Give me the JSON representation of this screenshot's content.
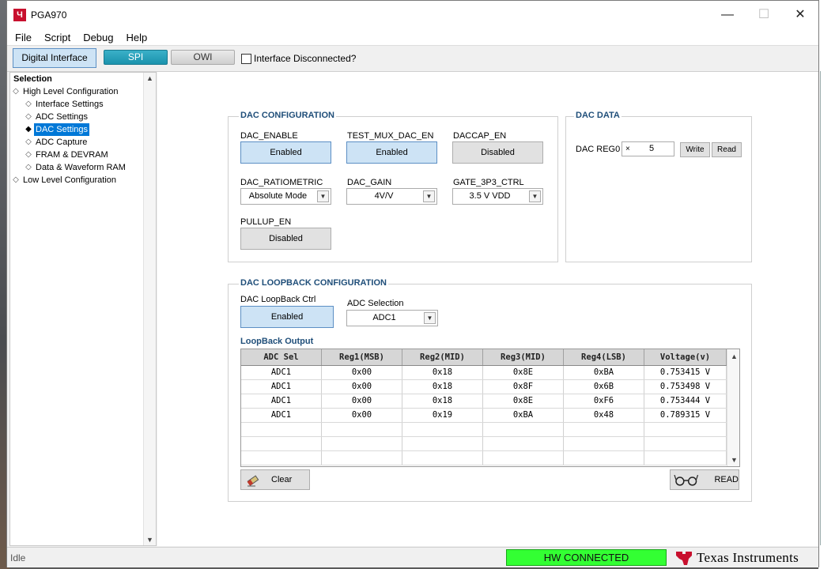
{
  "window": {
    "title": "PGA970",
    "app_icon_glyph": "Ч",
    "min_glyph": "—",
    "max_glyph": "☐",
    "close_glyph": "✕"
  },
  "menu": [
    "File",
    "Script",
    "Debug",
    "Help"
  ],
  "toolbar": {
    "digital_interface": "Digital Interface",
    "spi": "SPI",
    "owi": "OWI",
    "interface_disconnected": "Interface Disconnected?"
  },
  "sidebar": {
    "header": "Selection",
    "items": [
      {
        "label": "High Level Configuration",
        "level": 0
      },
      {
        "label": "Interface Settings",
        "level": 1
      },
      {
        "label": "ADC Settings",
        "level": 1
      },
      {
        "label": "DAC Settings",
        "level": 1,
        "selected": true
      },
      {
        "label": "ADC Capture",
        "level": 1
      },
      {
        "label": "FRAM & DEVRAM",
        "level": 1
      },
      {
        "label": "Data & Waveform RAM",
        "level": 1
      },
      {
        "label": "Low Level Configuration",
        "level": 0
      }
    ]
  },
  "dac_config": {
    "title": "DAC CONFIGURATION",
    "dac_enable": {
      "label": "DAC_ENABLE",
      "value": "Enabled"
    },
    "test_mux": {
      "label": "TEST_MUX_DAC_EN",
      "value": "Enabled"
    },
    "daccap": {
      "label": "DACCAP_EN",
      "value": "Disabled"
    },
    "ratiometric": {
      "label": "DAC_RATIOMETRIC",
      "value": "Absolute Mode"
    },
    "gain": {
      "label": "DAC_GAIN",
      "value": "4V/V"
    },
    "gate": {
      "label": "GATE_3P3_CTRL",
      "value": "3.5 V VDD"
    },
    "pullup": {
      "label": "PULLUP_EN",
      "value": "Disabled"
    }
  },
  "dac_data": {
    "title": "DAC DATA",
    "reg_label": "DAC REG0",
    "reg_prefix": "×",
    "reg_value": "5",
    "write": "Write",
    "read": "Read"
  },
  "loopback": {
    "title": "DAC LOOPBACK CONFIGURATION",
    "ctrl_label": "DAC LoopBack Ctrl",
    "ctrl_value": "Enabled",
    "adc_sel_label": "ADC Selection",
    "adc_sel_value": "ADC1",
    "output_label": "LoopBack Output",
    "columns": [
      "ADC Sel",
      "Reg1(MSB)",
      "Reg2(MID)",
      "Reg3(MID)",
      "Reg4(LSB)",
      "Voltage(v)"
    ],
    "rows": [
      [
        "ADC1",
        "0x00",
        "0x18",
        "0x8E",
        "0xBA",
        "0.753415 V"
      ],
      [
        "ADC1",
        "0x00",
        "0x18",
        "0x8F",
        "0x6B",
        "0.753498 V"
      ],
      [
        "ADC1",
        "0x00",
        "0x18",
        "0x8E",
        "0xF6",
        "0.753444 V"
      ],
      [
        "ADC1",
        "0x00",
        "0x19",
        "0xBA",
        "0x48",
        "0.789315 V"
      ],
      [
        "",
        "",
        "",
        "",
        "",
        ""
      ],
      [
        "",
        "",
        "",
        "",
        "",
        ""
      ],
      [
        "",
        "",
        "",
        "",
        "",
        ""
      ]
    ],
    "clear": "Clear",
    "read": "READ"
  },
  "status": {
    "text": "Idle",
    "hw": "HW CONNECTED",
    "brand": "Texas Instruments",
    "hw_color": "#33ff33"
  }
}
